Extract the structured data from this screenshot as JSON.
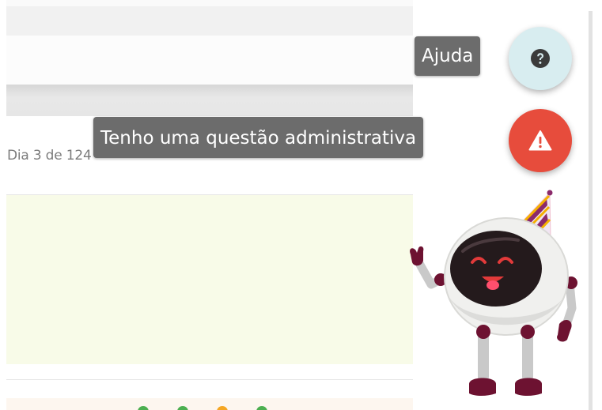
{
  "lesson": {
    "day_counter": "Dia 3 de 124"
  },
  "help_buttons": {
    "help_label": "Ajuda",
    "admin_label": "Tenho uma questão administrativa"
  },
  "colors": {
    "content_panel": "#f8fbe8",
    "help_button": "#d8edf0",
    "admin_button": "#e74c3c",
    "tooltip": "#6c6c6c"
  },
  "icons": [
    "question-icon",
    "warning-icon"
  ],
  "mascot": "party-robot-mascot"
}
